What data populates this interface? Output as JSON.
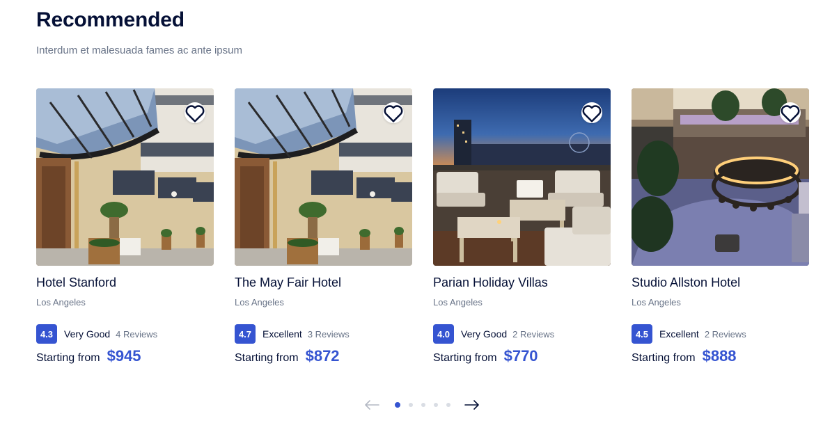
{
  "section": {
    "title": "Recommended",
    "subtitle": "Interdum et malesuada fames ac ante ipsum"
  },
  "hotels": [
    {
      "name": "Hotel Stanford",
      "location": "Los Angeles",
      "rating": "4.3",
      "rating_text": "Very Good",
      "reviews": "4 Reviews",
      "price_label": "Starting from",
      "price": "$945",
      "image": "hotel-entrance-canopy"
    },
    {
      "name": "The May Fair Hotel",
      "location": "Los Angeles",
      "rating": "4.7",
      "rating_text": "Excellent",
      "reviews": "3 Reviews",
      "price_label": "Starting from",
      "price": "$872",
      "image": "hotel-entrance-canopy"
    },
    {
      "name": "Parian Holiday Villas",
      "location": "Los Angeles",
      "rating": "4.0",
      "rating_text": "Very Good",
      "reviews": "2 Reviews",
      "price_label": "Starting from",
      "price": "$770",
      "image": "rooftop-terrace-dusk"
    },
    {
      "name": "Studio Allston Hotel",
      "location": "Los Angeles",
      "rating": "4.5",
      "rating_text": "Excellent",
      "reviews": "2 Reviews",
      "price_label": "Starting from",
      "price": "$888",
      "image": "atrium-bar-lounge"
    }
  ],
  "icons": {
    "favorite": "heart-outline-icon",
    "prev": "arrow-left-icon",
    "next": "arrow-right-icon"
  },
  "pagination": {
    "total": 5,
    "active": 1
  },
  "colors": {
    "accent": "#3554d1",
    "heading": "#051036",
    "muted": "#697488",
    "dot_inactive": "#d9dde4"
  }
}
